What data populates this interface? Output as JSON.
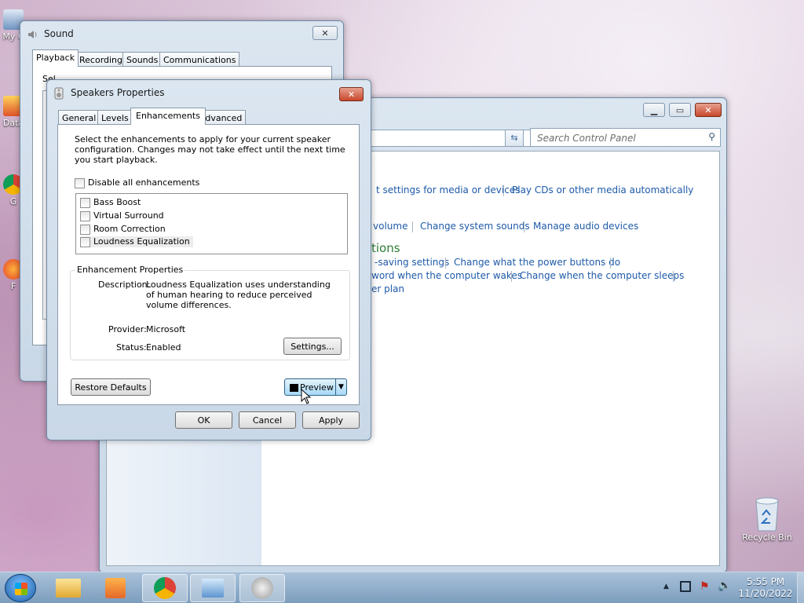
{
  "desktop": {
    "icons": [
      {
        "label": "My C"
      },
      {
        "label": "Data"
      },
      {
        "label": "G"
      },
      {
        "label": "F"
      }
    ],
    "recycle_bin": "Recycle Bin"
  },
  "control_panel": {
    "search_placeholder": "Search Control Panel",
    "links": {
      "autoplay_settings": "t settings for media or devices",
      "play_cds": "Play CDs or other media automatically",
      "volume": "volume",
      "change_system_sounds": "Change system sounds",
      "manage_audio": "Manage audio devices",
      "section_power": "tions",
      "power_saving": "-saving settings",
      "power_buttons": "Change what the power buttons do",
      "password_wake": "word when the computer wakes",
      "computer_sleeps": "Change when the computer sleeps",
      "power_plan": "er plan"
    }
  },
  "sound_window": {
    "title": "Sound",
    "tabs": [
      "Playback",
      "Recording",
      "Sounds",
      "Communications"
    ],
    "partial_text": "Sel..."
  },
  "speakers_dialog": {
    "title": "Speakers Properties",
    "tabs": [
      "General",
      "Levels",
      "Enhancements",
      "Advanced"
    ],
    "instructions": "Select the enhancements to apply for your current speaker configuration. Changes may not take effect until the next time you start playback.",
    "disable_all": "Disable all enhancements",
    "enhancements": [
      "Bass Boost",
      "Virtual Surround",
      "Room Correction",
      "Loudness Equalization"
    ],
    "group_title": "Enhancement Properties",
    "description_label": "Description:",
    "description_value": "Loudness Equalization uses understanding of human hearing to reduce perceived volume differences.",
    "provider_label": "Provider:",
    "provider_value": "Microsoft",
    "status_label": "Status:",
    "status_value": "Enabled",
    "settings_button": "Settings...",
    "restore_defaults": "Restore Defaults",
    "preview": "Preview",
    "ok": "OK",
    "cancel": "Cancel",
    "apply": "Apply"
  },
  "taskbar": {
    "time": "5:55 PM",
    "date": "11/20/2022"
  }
}
